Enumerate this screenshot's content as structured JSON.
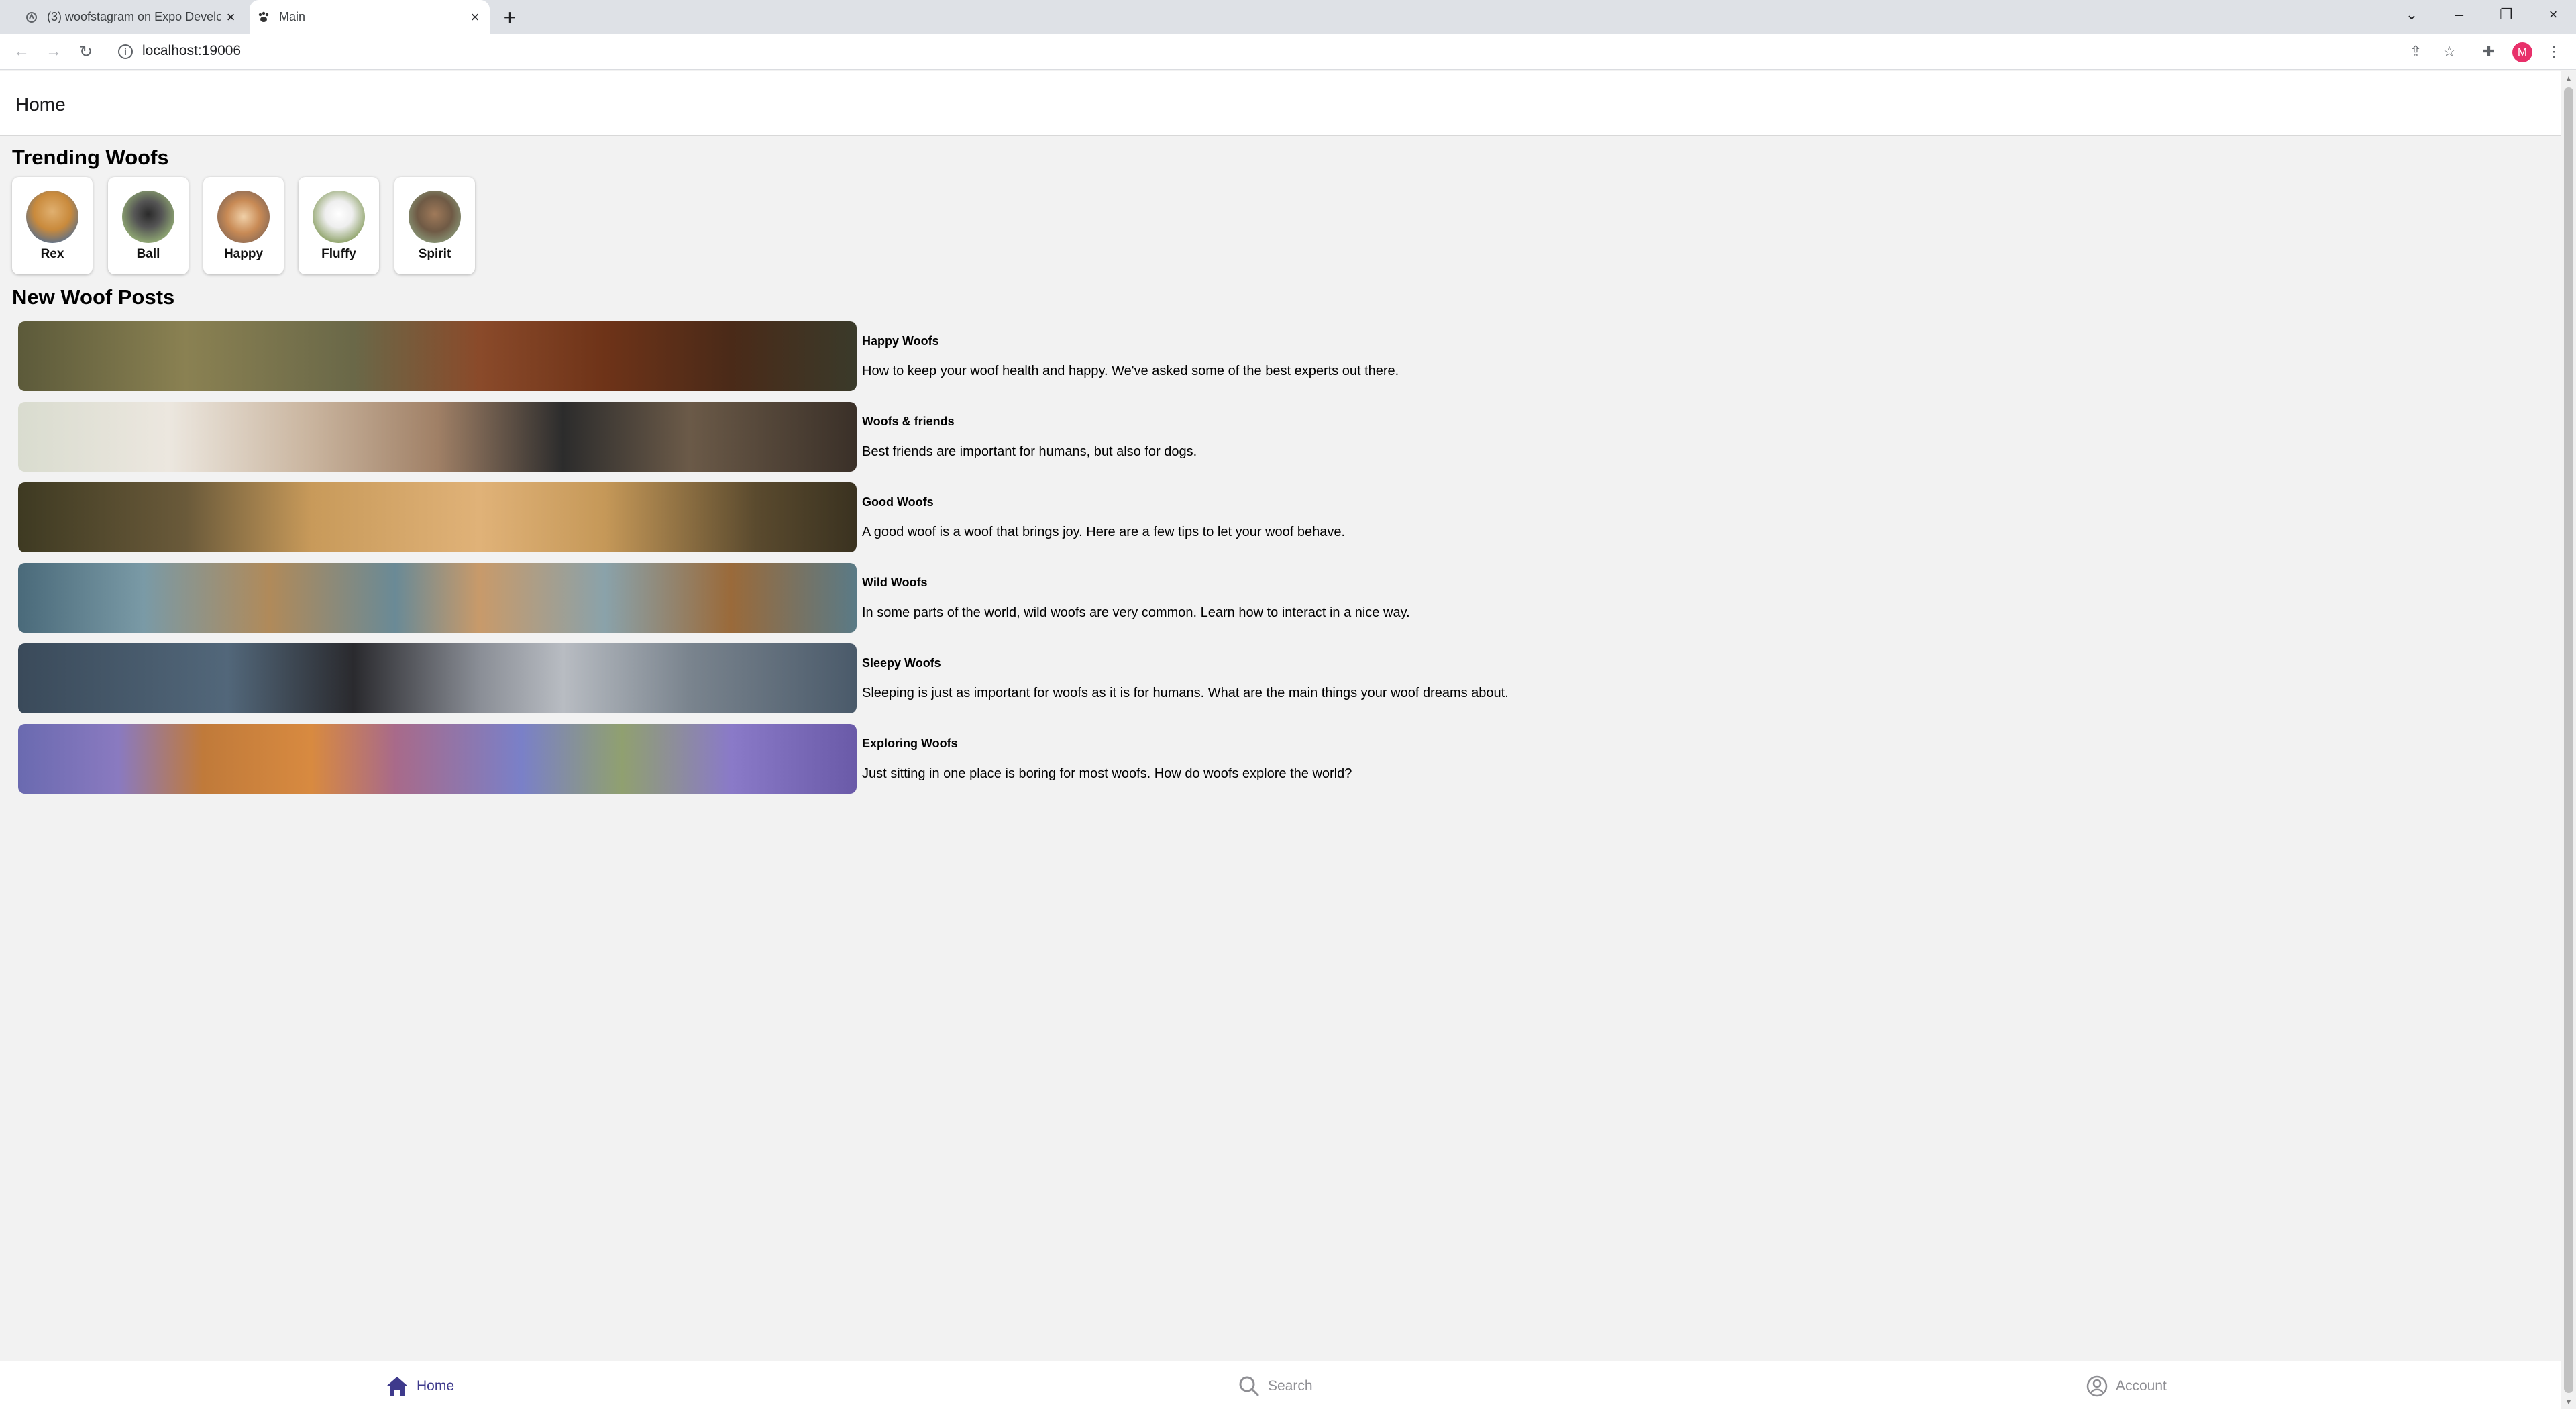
{
  "browser": {
    "tabs": [
      {
        "title": "(3) woofstagram on Expo Develo",
        "active": false
      },
      {
        "title": "Main",
        "active": true
      }
    ],
    "url": "localhost:19006",
    "profile_initial": "M"
  },
  "app": {
    "header_title": "Home",
    "trending": {
      "heading": "Trending Woofs",
      "items": [
        {
          "name": "Rex"
        },
        {
          "name": "Ball"
        },
        {
          "name": "Happy"
        },
        {
          "name": "Fluffy"
        },
        {
          "name": "Spirit"
        }
      ]
    },
    "posts": {
      "heading": "New Woof Posts",
      "items": [
        {
          "title": "Happy Woofs",
          "description": "How to keep your woof health and happy. We've asked some of the best experts out there."
        },
        {
          "title": "Woofs & friends",
          "description": "Best friends are important for humans, but also for dogs."
        },
        {
          "title": "Good Woofs",
          "description": "A good woof is a woof that brings joy. Here are a few tips to let your woof behave."
        },
        {
          "title": "Wild Woofs",
          "description": "In some parts of the world, wild woofs are very common. Learn how to interact in a nice way."
        },
        {
          "title": "Sleepy Woofs",
          "description": "Sleeping is just as important for woofs as it is for humans. What are the main things your woof dreams about."
        },
        {
          "title": "Exploring Woofs",
          "description": "Just sitting in one place is boring for most woofs. How do woofs explore the world?"
        }
      ]
    },
    "bottom_tabs": [
      {
        "label": "Home",
        "icon": "home-icon",
        "active": true
      },
      {
        "label": "Search",
        "icon": "search-icon",
        "active": false
      },
      {
        "label": "Account",
        "icon": "account-icon",
        "active": false
      }
    ],
    "colors": {
      "accent": "#3e3a8c",
      "inactive_tab": "#8e8e93",
      "background": "#f2f2f2"
    }
  }
}
